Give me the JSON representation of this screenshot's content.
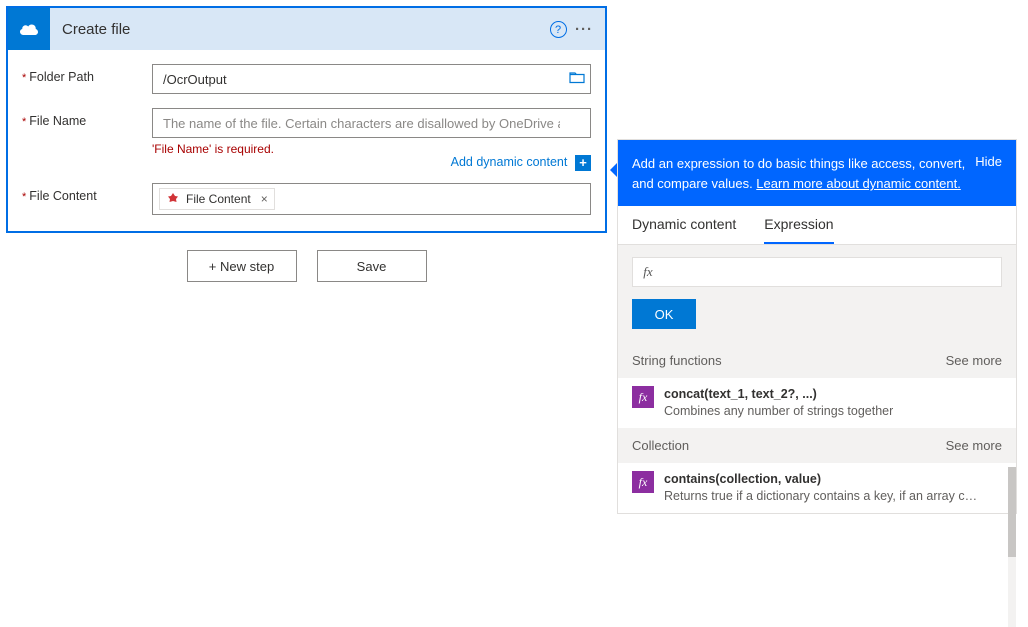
{
  "card": {
    "title": "Create file",
    "fields": {
      "folder": {
        "label": "Folder Path",
        "value": "/OcrOutput"
      },
      "filename": {
        "label": "File Name",
        "placeholder": "The name of the file. Certain characters are disallowed by OneDrive and will be",
        "error": "'File Name' is required."
      },
      "content": {
        "label": "File Content",
        "chip": "File Content"
      }
    },
    "add_dynamic": "Add dynamic content"
  },
  "actions": {
    "new_step": "+ New step",
    "save": "Save"
  },
  "flyout": {
    "desc_pre": "Add an expression to do basic things like access, convert, and compare values. ",
    "desc_link": "Learn more about dynamic content.",
    "hide": "Hide",
    "tabs": {
      "dynamic": "Dynamic content",
      "expression": "Expression"
    },
    "fx_label": "fx",
    "ok": "OK",
    "sections": [
      {
        "title": "String functions",
        "see_more": "See more",
        "items": [
          {
            "sig": "concat(text_1, text_2?, ...)",
            "desc": "Combines any number of strings together"
          }
        ]
      },
      {
        "title": "Collection",
        "see_more": "See more",
        "items": [
          {
            "sig": "contains(collection, value)",
            "desc": "Returns true if a dictionary contains a key, if an array cont…"
          }
        ]
      }
    ]
  }
}
